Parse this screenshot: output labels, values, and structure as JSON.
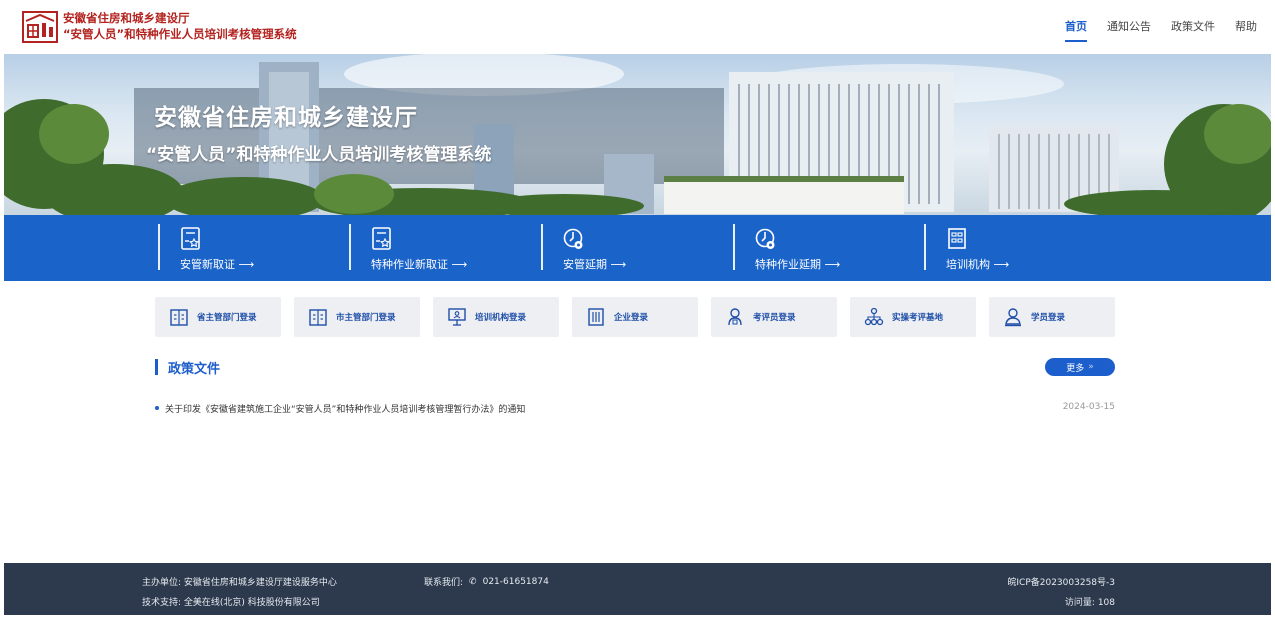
{
  "header": {
    "title_line1": "安徽省住房和城乡建设厅",
    "title_line2": "“安管人员”和特种作业人员培训考核管理系统",
    "nav": [
      "首页",
      "通知公告",
      "政策文件",
      "帮助"
    ],
    "active_nav": "首页"
  },
  "banner": {
    "title": "安徽省住房和城乡建设厅",
    "subtitle": "“安管人员”和特种作业人员培训考核管理系统"
  },
  "actions": [
    {
      "label": "安管新取证 ⟶",
      "icon": "certificate-icon"
    },
    {
      "label": "特种作业新取证 ⟶",
      "icon": "certificate-icon"
    },
    {
      "label": "安管延期 ⟶",
      "icon": "clock-icon"
    },
    {
      "label": "特种作业延期 ⟶",
      "icon": "clock-icon"
    },
    {
      "label": "培训机构 ⟶",
      "icon": "building-icon"
    }
  ],
  "logins": [
    {
      "label": "省主管部门登录",
      "icon": "building-icon"
    },
    {
      "label": "市主管部门登录",
      "icon": "building-icon"
    },
    {
      "label": "培训机构登录",
      "icon": "presentation-icon"
    },
    {
      "label": "企业登录",
      "icon": "office-icon"
    },
    {
      "label": "考评员登录",
      "icon": "examiner-icon"
    },
    {
      "label": "实操考评基地",
      "icon": "org-chart-icon"
    },
    {
      "label": "学员登录",
      "icon": "user-icon"
    }
  ],
  "policy": {
    "title": "政策文件",
    "more": "更多",
    "items": [
      {
        "text": "关于印发《安徽省建筑施工企业“安管人员”和特种作业人员培训考核管理暂行办法》的通知",
        "date": "2024-03-15"
      }
    ]
  },
  "footer": {
    "host": "主办单位: 安徽省住房和城乡建设厅建设服务中心",
    "support": "技术支持: 全美在线(北京) 科技股份有限公司",
    "contact_label": "联系我们:",
    "phone": "021-61651874",
    "icp": "皖ICP备2023003258号-3",
    "visits": "访问量: 108"
  },
  "colors": {
    "brand_red": "#b3231f",
    "primary_blue": "#1a63c9",
    "footer_bg": "#2d3a4d"
  }
}
